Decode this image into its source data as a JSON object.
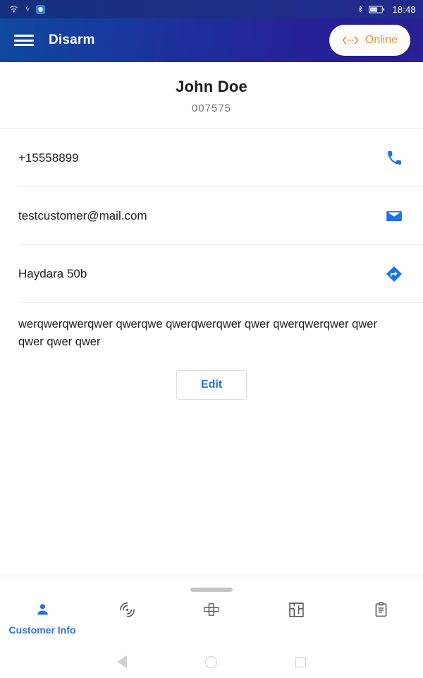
{
  "status_bar": {
    "time": "18:48",
    "left_icons": [
      "wifi-icon",
      "usb-icon",
      "shield-app-icon"
    ],
    "right_icons": [
      "bluetooth-icon",
      "battery-charging-icon"
    ]
  },
  "app_bar": {
    "menu_icon": "hamburger-menu-icon",
    "title": "Disarm",
    "status_pill": {
      "icon": "connection-icon",
      "label": "Online",
      "text_color": "#e8943a",
      "background": "#fdfcfa"
    },
    "gradient_from": "#0e4a9e",
    "gradient_to": "#2a1f93"
  },
  "customer": {
    "name": "John Doe",
    "account_id": "007575",
    "rows": [
      {
        "value": "+15558899",
        "icon": "phone-icon",
        "icon_color": "#1a73e8"
      },
      {
        "value": "testcustomer@mail.com",
        "icon": "email-icon",
        "icon_color": "#1a73e8"
      },
      {
        "value": "Haydara 50b",
        "icon": "directions-icon",
        "icon_color": "#1a73e8"
      }
    ],
    "notes": "werqwerqwerqwer qwerqwe qwerqwerqwer qwer qwerqwerqwer qwer qwer qwer qwer",
    "edit_label": "Edit"
  },
  "bottom_tabs": {
    "items": [
      {
        "label": "Customer Info",
        "icon": "person-icon",
        "active": true
      },
      {
        "label": "",
        "icon": "sensor-icon",
        "active": false
      },
      {
        "label": "",
        "icon": "zones-icon",
        "active": false
      },
      {
        "label": "",
        "icon": "floorplan-icon",
        "active": false
      },
      {
        "label": "",
        "icon": "clipboard-icon",
        "active": false
      }
    ],
    "active_color": "#2b6fe0",
    "inactive_color": "#5f6368",
    "drag_handle": "sheet-drag-handle"
  },
  "android_nav": {
    "back": "back-triangle-icon",
    "home": "home-circle-icon",
    "recents": "recents-square-icon"
  }
}
